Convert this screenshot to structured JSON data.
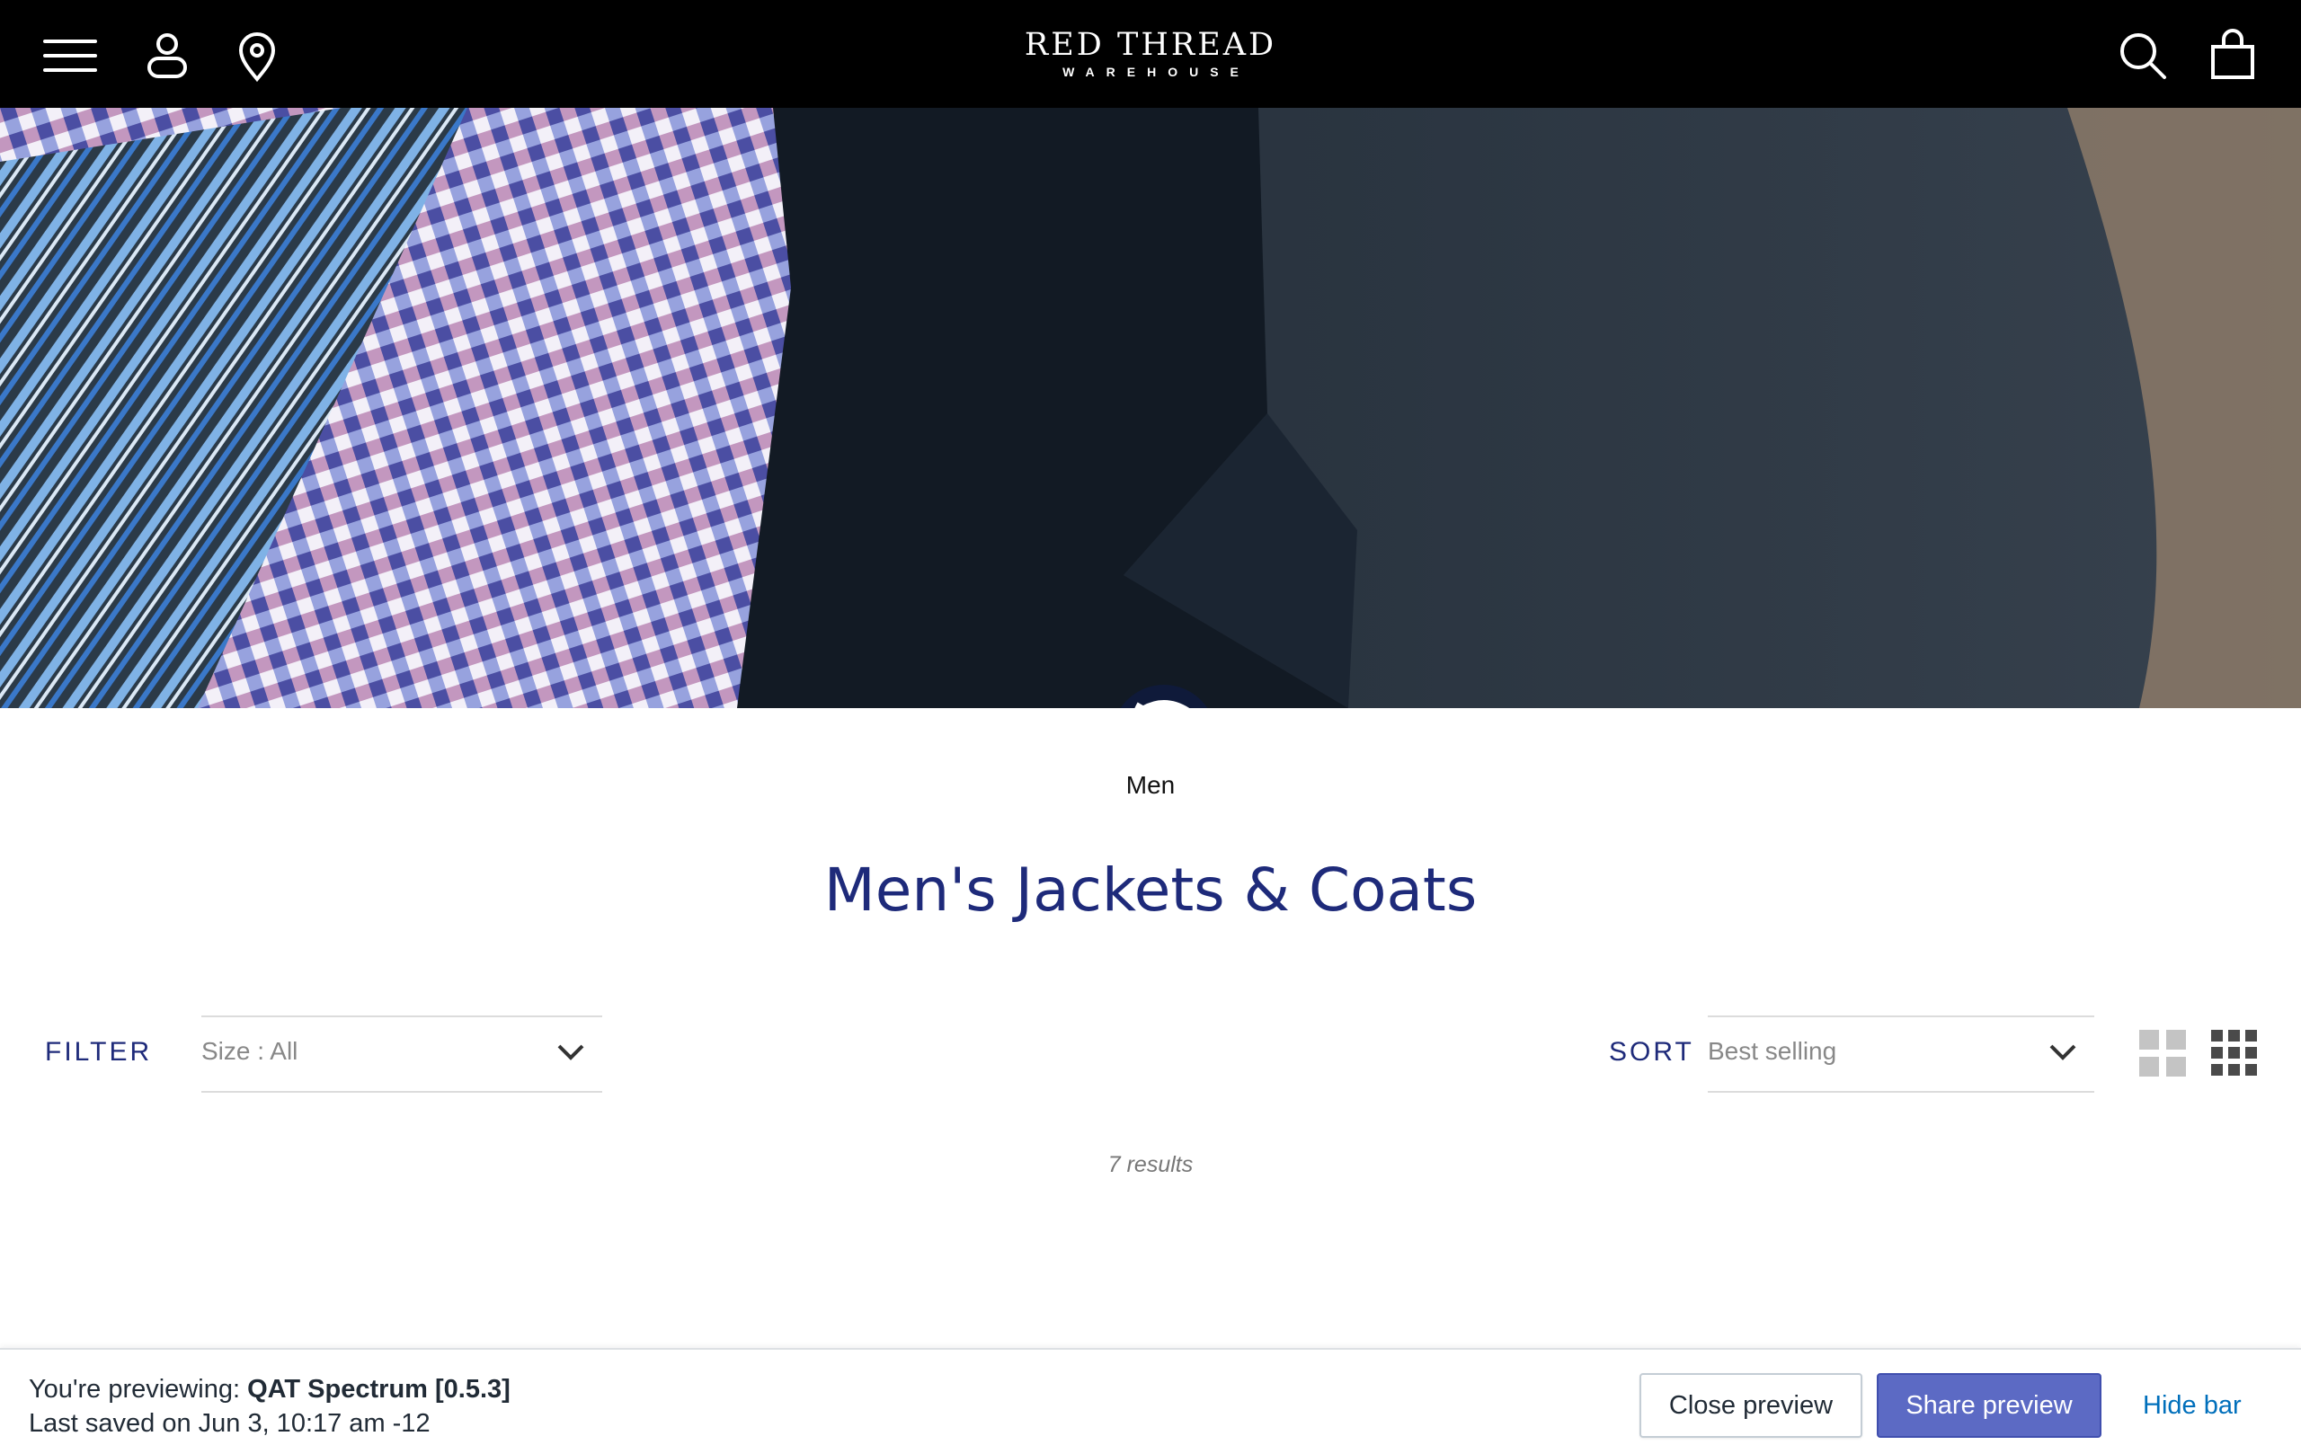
{
  "header": {
    "logo_main": "RED THREAD",
    "logo_sub": "WAREHOUSE",
    "icons": [
      "menu-icon",
      "account-icon",
      "location-icon",
      "search-icon",
      "cart-icon"
    ]
  },
  "breadcrumb": "Men",
  "title": "Men's Jackets & Coats",
  "filter": {
    "label": "FILTER",
    "value": "Size : All"
  },
  "sort": {
    "label": "SORT",
    "value": "Best selling"
  },
  "results": "7 results",
  "preview_bar": {
    "prefix": "You're previewing: ",
    "theme_name": "QAT Spectrum [0.5.3]",
    "last_saved": "Last saved on Jun 3, 10:17 am -12",
    "close_label": "Close preview",
    "share_label": "Share preview",
    "hide_label": "Hide bar"
  },
  "colors": {
    "accent": "#1e2a7a",
    "share_button": "#5c6ac4",
    "hide_link": "#006fbb",
    "header_bg": "#000000"
  }
}
